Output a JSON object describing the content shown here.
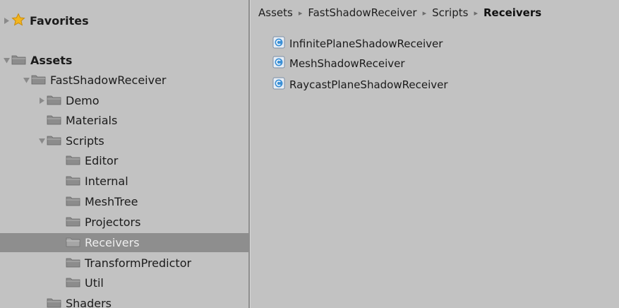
{
  "window": {
    "title": ""
  },
  "sidebar": {
    "favorites_label": "Favorites",
    "tree": [
      {
        "label": "Assets",
        "bold": true,
        "expanded": true,
        "icon": "folder-icon"
      },
      {
        "label": "FastShadowReceiver",
        "expanded": true,
        "icon": "folder-icon"
      },
      {
        "label": "Demo",
        "expanded": false,
        "icon": "folder-icon"
      },
      {
        "label": "Materials",
        "icon": "folder-icon"
      },
      {
        "label": "Scripts",
        "expanded": true,
        "icon": "folder-icon"
      },
      {
        "label": "Editor",
        "icon": "folder-icon"
      },
      {
        "label": "Internal",
        "icon": "folder-icon"
      },
      {
        "label": "MeshTree",
        "icon": "folder-icon"
      },
      {
        "label": "Projectors",
        "icon": "folder-icon"
      },
      {
        "label": "Receivers",
        "selected": true,
        "icon": "folder-icon"
      },
      {
        "label": "TransformPredictor",
        "icon": "folder-icon"
      },
      {
        "label": "Util",
        "icon": "folder-icon"
      },
      {
        "label": "Shaders",
        "icon": "folder-icon"
      }
    ]
  },
  "breadcrumb": {
    "items": [
      "Assets",
      "FastShadowReceiver",
      "Scripts",
      "Receivers"
    ],
    "separator": "▸"
  },
  "assets": {
    "items": [
      {
        "label": "InfinitePlaneShadowReceiver",
        "icon": "csharp-script-icon"
      },
      {
        "label": "MeshShadowReceiver",
        "icon": "csharp-script-icon"
      },
      {
        "label": "RaycastPlaneShadowReceiver",
        "icon": "csharp-script-icon"
      }
    ]
  },
  "colors": {
    "background": "#c2c2c2",
    "selected_row": "#8e8e8e",
    "folder": "#8c8c8c",
    "script_icon": "#3a8fd6",
    "star": "#f2b51f"
  }
}
